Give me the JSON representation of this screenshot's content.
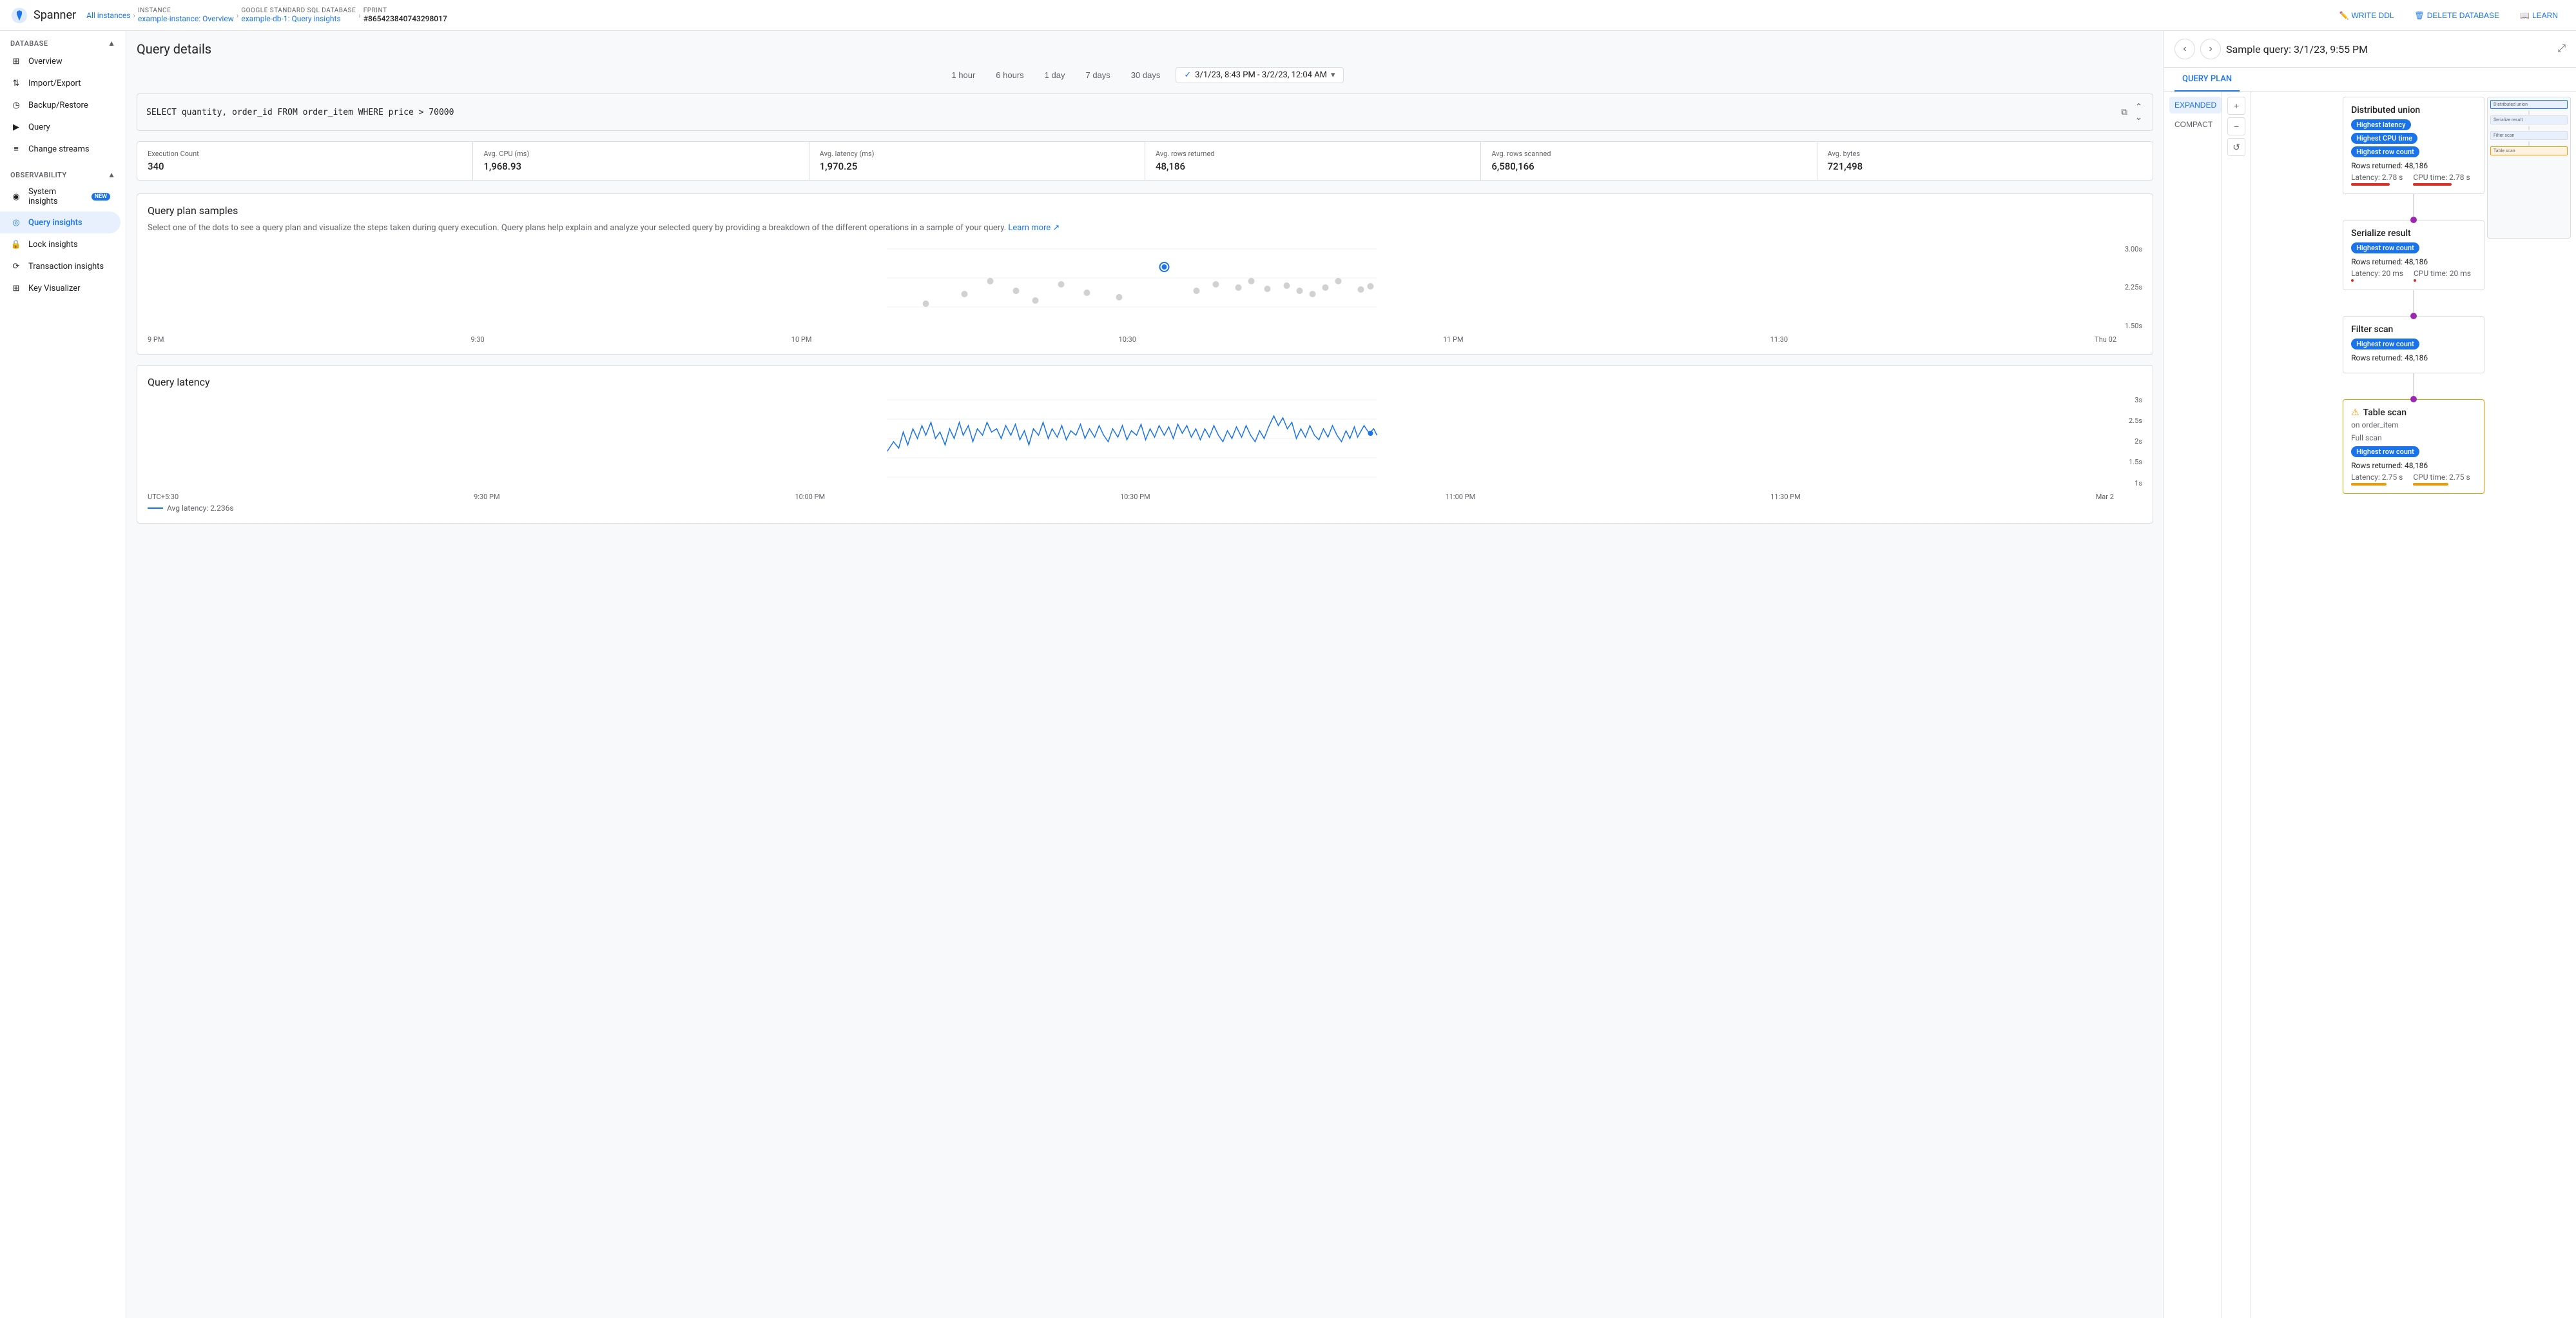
{
  "topbar": {
    "logo": "Spanner",
    "breadcrumbs": [
      {
        "label": "",
        "text": "All instances",
        "link": true
      },
      {
        "label": "INSTANCE",
        "text": "example-instance: Overview",
        "link": true
      },
      {
        "label": "GOOGLE STANDARD SQL DATABASE",
        "text": "example-db-1: Query insights",
        "link": true
      },
      {
        "label": "FPRINT",
        "text": "#865423840743298017",
        "link": false
      }
    ],
    "actions": [
      {
        "label": "WRITE DDL",
        "icon": "pencil-icon"
      },
      {
        "label": "DELETE DATABASE",
        "icon": "trash-icon"
      },
      {
        "label": "LEARN",
        "icon": "book-icon"
      }
    ]
  },
  "sidebar": {
    "db_section": "DATABASE",
    "db_items": [
      {
        "label": "Overview",
        "icon": "grid-icon"
      },
      {
        "label": "Import/Export",
        "icon": "import-icon"
      },
      {
        "label": "Backup/Restore",
        "icon": "backup-icon"
      },
      {
        "label": "Query",
        "icon": "query-icon"
      },
      {
        "label": "Change streams",
        "icon": "streams-icon"
      }
    ],
    "obs_section": "OBSERVABILITY",
    "obs_items": [
      {
        "label": "System insights",
        "badge": "NEW",
        "icon": "system-icon",
        "active": false
      },
      {
        "label": "Query insights",
        "badge": "",
        "icon": "query-insights-icon",
        "active": true
      },
      {
        "label": "Lock insights",
        "badge": "",
        "icon": "lock-icon",
        "active": false
      },
      {
        "label": "Transaction insights",
        "badge": "",
        "icon": "transaction-icon",
        "active": false
      },
      {
        "label": "Key Visualizer",
        "badge": "",
        "icon": "key-icon",
        "active": false
      }
    ]
  },
  "page": {
    "title": "Query details",
    "time_buttons": [
      "1 hour",
      "6 hours",
      "1 day",
      "7 days",
      "30 days"
    ],
    "time_range": "3/1/23, 8:43 PM - 3/2/23, 12:04 AM",
    "sql": "SELECT quantity, order_id FROM order_item WHERE price > 70000",
    "stats": [
      {
        "label": "Execution Count",
        "value": "340"
      },
      {
        "label": "Avg. CPU (ms)",
        "value": "1,968.93"
      },
      {
        "label": "Avg. latency (ms)",
        "value": "1,970.25"
      },
      {
        "label": "Avg. rows returned",
        "value": "48,186"
      },
      {
        "label": "Avg. rows scanned",
        "value": "6,580,166"
      },
      {
        "label": "Avg. bytes",
        "value": "721,498"
      }
    ],
    "scatter_section": {
      "title": "Query plan samples",
      "description": "Select one of the dots to see a query plan and visualize the steps taken during query execution. Query plans help explain and analyze your selected query by providing a breakdown of the different operations in a sample of your query.",
      "learn_more": "Learn more",
      "y_labels": [
        "3.00s",
        "2.25s",
        "1.50s"
      ],
      "x_labels": [
        "9 PM",
        "9:30",
        "10 PM",
        "10:30",
        "11 PM",
        "11:30",
        "Thu 02"
      ]
    },
    "latency_section": {
      "title": "Query latency",
      "y_labels": [
        "3s",
        "2.5s",
        "2s",
        "1.5s",
        "1s"
      ],
      "x_labels": [
        "UTC+5:30",
        "9:30 PM",
        "10:00 PM",
        "10:30 PM",
        "11:00 PM",
        "11:30 PM",
        "Mar 2"
      ],
      "legend_label": "Avg latency: 2.236s"
    }
  },
  "right_panel": {
    "title": "Sample query: 3/1/23, 9:55 PM",
    "tabs": [
      "QUERY PLAN"
    ],
    "views": [
      "EXPANDED",
      "COMPACT"
    ],
    "nodes": [
      {
        "title": "Distributed union",
        "badges": [
          "Highest latency",
          "Highest CPU time",
          "Highest row count"
        ],
        "badge_types": [
          "blue",
          "blue",
          "blue"
        ],
        "rows_returned": "Rows returned: 48,186",
        "latency": "Latency: 2.78 s",
        "cpu_time": "CPU time: 2.78 s",
        "latency_bar_type": "red",
        "cpu_bar_type": "red",
        "warning": false
      },
      {
        "title": "Serialize result",
        "badges": [
          "Highest row count"
        ],
        "badge_types": [
          "blue"
        ],
        "rows_returned": "Rows returned: 48,186",
        "latency": "Latency: 20 ms",
        "cpu_time": "CPU time: 20 ms",
        "latency_bar_type": "red",
        "cpu_bar_type": "red",
        "warning": false
      },
      {
        "title": "Filter scan",
        "badges": [
          "Highest row count"
        ],
        "badge_types": [
          "blue"
        ],
        "rows_returned": "Rows returned: 48,186",
        "latency": "",
        "cpu_time": "",
        "latency_bar_type": "",
        "cpu_bar_type": "",
        "warning": false
      },
      {
        "title": "Table scan",
        "subtitle": "on order_item",
        "sub2": "Full scan",
        "badges": [
          "Highest row count"
        ],
        "badge_types": [
          "blue"
        ],
        "rows_returned": "Rows returned: 48,186",
        "latency": "Latency: 2.75 s",
        "cpu_time": "CPU time: 2.75 s",
        "latency_bar_type": "orange",
        "cpu_bar_type": "orange",
        "warning": true
      }
    ]
  }
}
